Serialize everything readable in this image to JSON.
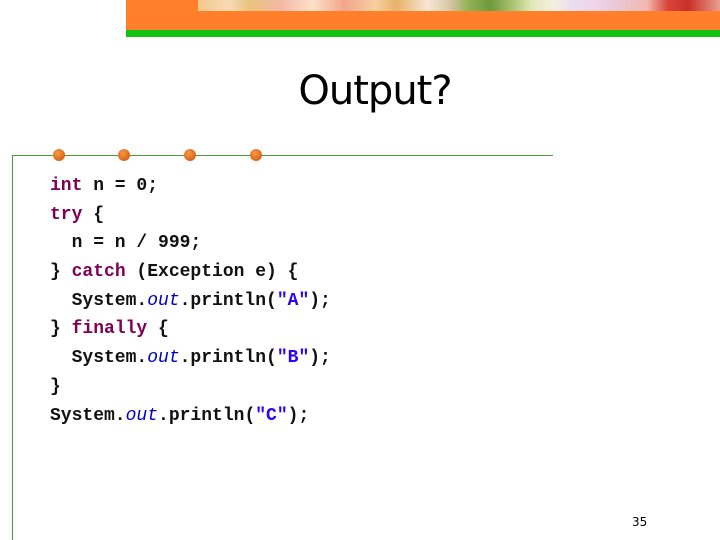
{
  "slide": {
    "title": "Output?",
    "page_number": "35",
    "colors": {
      "banner_orange": "#ff7f2a",
      "banner_green": "#12c212",
      "rule_green": "#4a9a3a",
      "bullet_orange": "#e2701e",
      "keyword": "#7f0055",
      "field": "#0000c0",
      "string": "#2a00ff",
      "text": "#111111"
    }
  },
  "code": {
    "language": "java",
    "lines": [
      [
        {
          "t": "kw",
          "v": "int"
        },
        {
          "t": "plain",
          "v": " n = 0;"
        }
      ],
      [
        {
          "t": "kw",
          "v": "try"
        },
        {
          "t": "plain",
          "v": " {"
        }
      ],
      [
        {
          "t": "plain",
          "v": "  n = n / 999;"
        }
      ],
      [
        {
          "t": "plain",
          "v": "} "
        },
        {
          "t": "kw",
          "v": "catch"
        },
        {
          "t": "plain",
          "v": " (Exception e) {"
        }
      ],
      [
        {
          "t": "plain",
          "v": "  System."
        },
        {
          "t": "fld",
          "v": "out"
        },
        {
          "t": "plain",
          "v": ".println("
        },
        {
          "t": "str",
          "v": "\"A\""
        },
        {
          "t": "plain",
          "v": ");"
        }
      ],
      [
        {
          "t": "plain",
          "v": "} "
        },
        {
          "t": "kw",
          "v": "finally"
        },
        {
          "t": "plain",
          "v": " {"
        }
      ],
      [
        {
          "t": "plain",
          "v": "  System."
        },
        {
          "t": "fld",
          "v": "out"
        },
        {
          "t": "plain",
          "v": ".println("
        },
        {
          "t": "str",
          "v": "\"B\""
        },
        {
          "t": "plain",
          "v": ");"
        }
      ],
      [
        {
          "t": "plain",
          "v": "}"
        }
      ],
      [
        {
          "t": "plain",
          "v": "System."
        },
        {
          "t": "fld",
          "v": "out"
        },
        {
          "t": "plain",
          "v": ".println("
        },
        {
          "t": "str",
          "v": "\"C\""
        },
        {
          "t": "plain",
          "v": ");"
        }
      ]
    ]
  }
}
